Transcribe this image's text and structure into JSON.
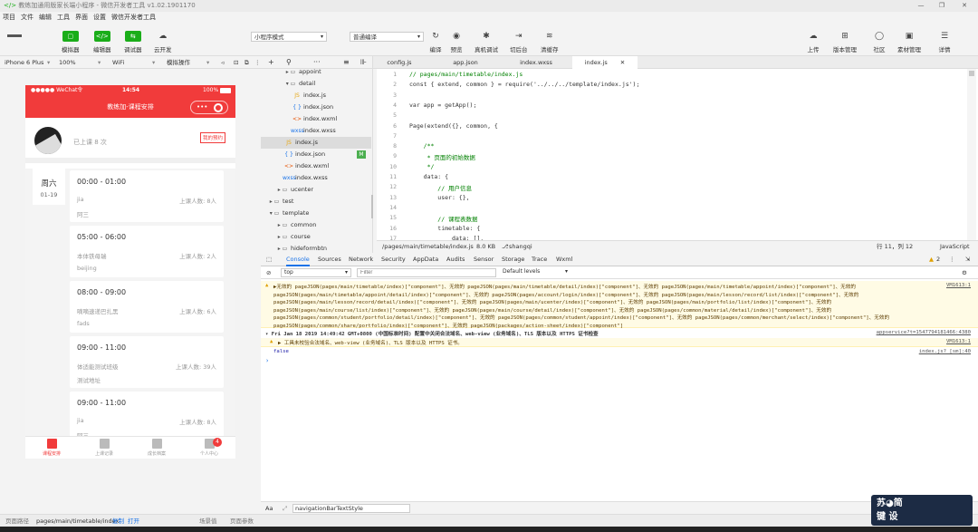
{
  "window": {
    "title": "教练加通用版家长端小程序 - 微信开发者工具 v1.02.1901170"
  },
  "menu": [
    "项目",
    "文件",
    "编辑",
    "工具",
    "界面",
    "设置",
    "微信开发者工具"
  ],
  "toolbar": {
    "simulator": "模拟器",
    "editor": "编辑器",
    "debugger": "调试器",
    "cloud": "云开发",
    "mode_select": "小程序模式",
    "compile_select": "普通编译",
    "compile": "编译",
    "preview": "预览",
    "remote_debug": "真机调试",
    "backend": "切后台",
    "clear_cache": "清缓存",
    "upload": "上传",
    "version": "版本管理",
    "community": "社区",
    "assets": "素材管理",
    "details": "详情"
  },
  "simbar": {
    "device": "iPhone 6 Plus",
    "zoom": "100%",
    "network": "WiFi",
    "operation": "模拟操作"
  },
  "phone": {
    "status_left": "●●●●● WeChat令",
    "status_time": "14:54",
    "status_right": "100%",
    "nav_title": "教练加-课程安排",
    "caps_dots": "•••",
    "attended": "已上课 8 次",
    "tag": "我的预约",
    "date_day": "周六",
    "date_num": "01-19",
    "cards": [
      {
        "time": "00:00 - 01:00",
        "name": "jia",
        "count": "上课人数: 8人",
        "addr": "阿三"
      },
      {
        "time": "05:00 - 06:00",
        "name": "本体铁母瑞",
        "count": "上课人数: 2人",
        "addr": "beijing"
      },
      {
        "time": "08:00 - 09:00",
        "name": "嘀嘀速递巴扎黑",
        "count": "上课人数: 6人",
        "addr": "fads"
      },
      {
        "time": "09:00 - 11:00",
        "name": "体适能测试班级",
        "count": "上课人数: 39人",
        "addr": "测试地址"
      },
      {
        "time": "09:00 - 11:00",
        "name": "jia",
        "count": "上课人数: 8人",
        "addr": "阿三"
      }
    ],
    "tabs": [
      "课程安排",
      "上课记录",
      "成长档案",
      "个人中心"
    ],
    "badge": "4"
  },
  "filetree": [
    {
      "label": "appoint",
      "indent": 2,
      "type": "folder-closed"
    },
    {
      "label": "detail",
      "indent": 2,
      "type": "folder-open"
    },
    {
      "label": "index.js",
      "indent": 3,
      "type": "js"
    },
    {
      "label": "index.json",
      "indent": 3,
      "type": "json"
    },
    {
      "label": "index.wxml",
      "indent": 3,
      "type": "wxml"
    },
    {
      "label": "index.wxss",
      "indent": 3,
      "type": "wxss"
    },
    {
      "label": "index.js",
      "indent": 2,
      "type": "js",
      "selected": true
    },
    {
      "label": "index.json",
      "indent": 2,
      "type": "json",
      "badge": "M"
    },
    {
      "label": "index.wxml",
      "indent": 2,
      "type": "wxml"
    },
    {
      "label": "index.wxss",
      "indent": 2,
      "type": "wxss"
    },
    {
      "label": "ucenter",
      "indent": 1,
      "type": "folder-closed"
    },
    {
      "label": "test",
      "indent": 0,
      "type": "folder-closed"
    },
    {
      "label": "template",
      "indent": 0,
      "type": "folder-open"
    },
    {
      "label": "common",
      "indent": 1,
      "type": "folder-closed"
    },
    {
      "label": "course",
      "indent": 1,
      "type": "folder-closed"
    },
    {
      "label": "hideformbtn",
      "indent": 1,
      "type": "folder-closed"
    }
  ],
  "editor_tabs": [
    "config.js",
    "app.json",
    "index.wxss",
    "index.js"
  ],
  "code": [
    {
      "n": "1",
      "t": "// pages/main/timetable/index.js",
      "c": "cm"
    },
    {
      "n": "2",
      "t": "const { extend, common } = require('../../../template/index.js');",
      "c": ""
    },
    {
      "n": "3",
      "t": "",
      "c": ""
    },
    {
      "n": "4",
      "t": "var app = getApp();",
      "c": ""
    },
    {
      "n": "5",
      "t": "",
      "c": ""
    },
    {
      "n": "6",
      "t": "Page(extend({}, common, {",
      "c": ""
    },
    {
      "n": "7",
      "t": "",
      "c": ""
    },
    {
      "n": "8",
      "t": "    /**",
      "c": "cm"
    },
    {
      "n": "9",
      "t": "     * 页面的初始数据",
      "c": "cm"
    },
    {
      "n": "10",
      "t": "     */",
      "c": "cm"
    },
    {
      "n": "11",
      "t": "    data: {",
      "c": ""
    },
    {
      "n": "12",
      "t": "        // 用户信息",
      "c": "cm"
    },
    {
      "n": "13",
      "t": "        user: {},",
      "c": ""
    },
    {
      "n": "14",
      "t": "",
      "c": ""
    },
    {
      "n": "15",
      "t": "        // 课程表数据",
      "c": "cm"
    },
    {
      "n": "16",
      "t": "        timetable: {",
      "c": ""
    },
    {
      "n": "17",
      "t": "            data: [],",
      "c": ""
    }
  ],
  "edstatus": {
    "path": "/pages/main/timetable/index.js",
    "size": "8.0 KB",
    "branch": "shangqi",
    "pos": "行 11，列 12",
    "lang": "JavaScript"
  },
  "devtools_tabs": [
    "Console",
    "Sources",
    "Network",
    "Security",
    "AppData",
    "Audits",
    "Sensor",
    "Storage",
    "Trace",
    "Wxml"
  ],
  "devtools_warn": "2",
  "filter": {
    "context": "top",
    "placeholder": "Filter",
    "levels": "Default levels"
  },
  "console": {
    "warn1": [
      "▶无效的 pageJSON(pages/main/timetable/index)[\"component\"]、无效的 pageJSON(pages/main/timetable/detail/index)[\"component\"]、无效的 pageJSON(pages/main/timetable/appoint/index)[\"component\"]、无效的",
      "pageJSON(pages/main/timetable/appoint/detail/index)[\"component\"]、无效的 pageJSON(pages/account/login/index)[\"component\"]、无效的 pageJSON(pages/main/lesson/record/list/index)[\"component\"]、无效的",
      "pageJSON(pages/main/lesson/record/detail/index)[\"component\"]、无效的 pageJSON(pages/main/ucenter/index)[\"component\"]、无效的 pageJSON(pages/main/portfolio/list/index)[\"component\"]、无效的",
      "pageJSON(pages/main/course/list/index)[\"component\"]、无效的 pageJSON(pages/main/course/detail/index)[\"component\"]、无效的 pageJSON(pages/common/material/detail/index)[\"component\"]、无效的",
      "pageJSON(pages/common/student/portfolio/detail/index)[\"component\"]、无效的 pageJSON(pages/common/student/appoint/index)[\"component\"]、无效的 pageJSON(pages/common/merchant/select/index)[\"component\"]、无效的",
      "pageJSON(pages/common/share/portfolio/index)[\"component\"]、无效的 pageJSON(packages/action-sheet/index)[\"component\"]"
    ],
    "warn1_link": "VM1613:1",
    "log2": "▾ Fri Jan 18 2019 14:49:42 GMT+0800 (中国标准时间) 配置中关闭合法域名、web-view (业务域名)、TLS 版本以及 HTTPS 证书检查",
    "log2_link": "appservice?t=1547794181466:4380",
    "warn3": "▶ 工具未校验合法域名、web-view (业务域名)、TLS 版本以及 HTTPS 证书。",
    "warn3_link": "VM1613:1",
    "false": "false",
    "false_link": "index.js? [sm]:40",
    "prompt": "›"
  },
  "console_input": {
    "label": "Aa",
    "value": "navigationBarTextStyle"
  },
  "statusbar": {
    "path_label": "页面路径",
    "path": "pages/main/timetable/index",
    "copy": "复制",
    "open": "打开",
    "scene": "场景值",
    "params": "页面参数"
  },
  "watermark": {
    "line1": "苏◕简",
    "line2": "键 设"
  }
}
